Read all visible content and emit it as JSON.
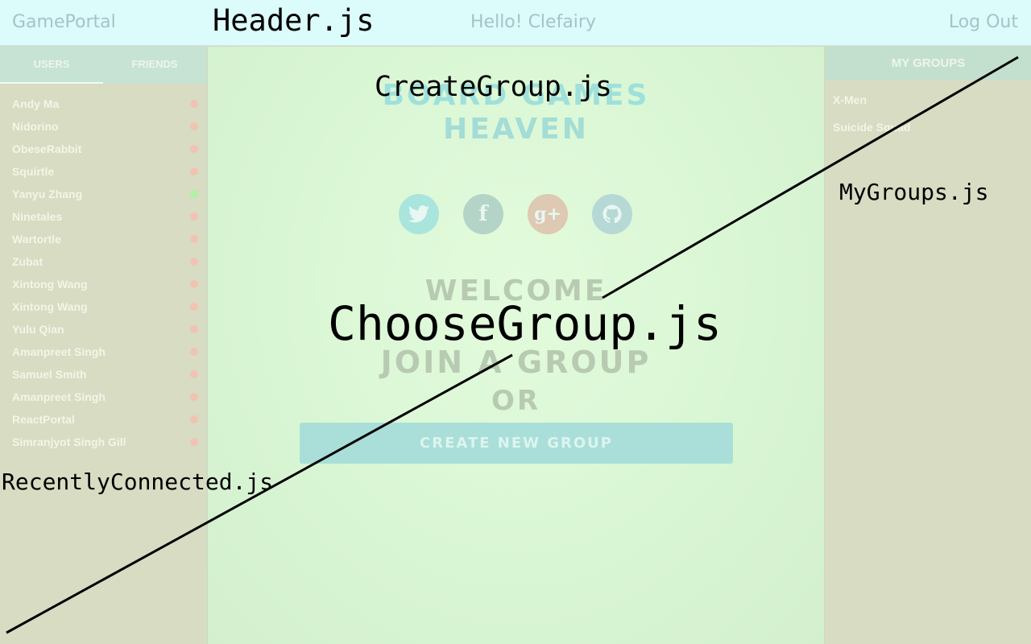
{
  "header": {
    "brand": "GamePortal",
    "greeting": "Hello! Clefairy",
    "logout_label": "Log Out"
  },
  "left_sidebar": {
    "tabs": [
      {
        "label": "USERS",
        "active": true
      },
      {
        "label": "FRIENDS",
        "active": false
      }
    ],
    "users": [
      {
        "name": "Andy Ma",
        "online": false
      },
      {
        "name": "Nidorino",
        "online": false
      },
      {
        "name": "ObeseRabbit",
        "online": false
      },
      {
        "name": "Squirtle",
        "online": false
      },
      {
        "name": "Yanyu Zhang",
        "online": true
      },
      {
        "name": "Ninetales",
        "online": false
      },
      {
        "name": "Wartortle",
        "online": false
      },
      {
        "name": "Zubat",
        "online": false
      },
      {
        "name": "Xintong Wang",
        "online": false
      },
      {
        "name": "Xintong Wang",
        "online": false
      },
      {
        "name": "Yulu Qian",
        "online": false
      },
      {
        "name": "Amanpreet Singh",
        "online": false
      },
      {
        "name": "Samuel Smith",
        "online": false
      },
      {
        "name": "Amanpreet Singh",
        "online": false
      },
      {
        "name": "ReactPortal",
        "online": false
      },
      {
        "name": "Simranjyot Singh Gill",
        "online": false
      }
    ]
  },
  "main": {
    "title_line1": "BOARD GAMES",
    "title_line2": "HEAVEN",
    "social_icons": [
      "twitter-icon",
      "facebook-icon",
      "google-plus-icon",
      "github-icon"
    ],
    "welcome": "WELCOME",
    "join": "JOIN A GROUP",
    "or": "OR",
    "create_button": "CREATE NEW GROUP"
  },
  "right_sidebar": {
    "title": "MY GROUPS",
    "groups": [
      "X-Men",
      "Suicide Squad"
    ]
  },
  "annotations": {
    "header": "Header.js",
    "create_group": "CreateGroup.js",
    "my_groups": "MyGroups.js",
    "choose_group": "ChooseGroup.js",
    "recently_connected": "RecentlyConnected.js"
  },
  "colors": {
    "online": "#b2f0a6",
    "offline": "#f2c3b2"
  }
}
